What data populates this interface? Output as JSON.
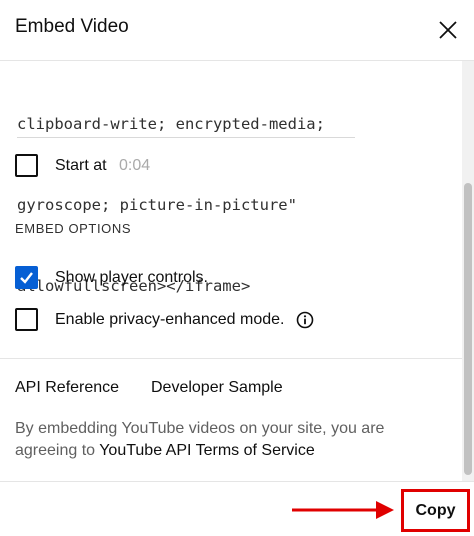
{
  "dialog": {
    "title": "Embed Video",
    "close_icon": "close-icon"
  },
  "embed_code": {
    "lines": [
      "clipboard-write; encrypted-media;",
      "gyroscope; picture-in-picture\"",
      "allowfullscreen></iframe>"
    ]
  },
  "start_at": {
    "label": "Start at",
    "time": "0:04",
    "checked": false
  },
  "embed_options": {
    "heading": "EMBED OPTIONS",
    "show_player_controls": {
      "label": "Show player controls.",
      "checked": true
    },
    "privacy_mode": {
      "label": "Enable privacy-enhanced mode.",
      "checked": false,
      "info_icon": "info-icon"
    }
  },
  "links": {
    "api_reference": "API Reference",
    "developer_sample": "Developer Sample"
  },
  "terms": {
    "text": "By embedding YouTube videos on your site, you are agreeing to ",
    "link": "YouTube API Terms of Service"
  },
  "footer": {
    "copy_label": "Copy"
  },
  "colors": {
    "accent_blue": "#065fd4",
    "annotation_red": "#e00000"
  }
}
